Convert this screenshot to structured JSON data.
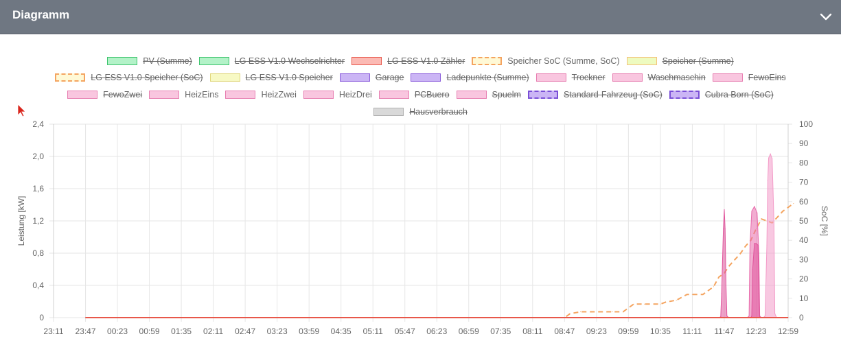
{
  "panel": {
    "title": "Diagramm",
    "collapse_icon": "chevron-down-icon",
    "header_color": "#6f7782"
  },
  "chart_data": {
    "type": "area",
    "title": "",
    "ylabel": "Leistung [kW]",
    "y2label": "SoC [%]",
    "ylim": [
      0,
      2.4
    ],
    "y2lim": [
      0,
      100
    ],
    "y_ticks": [
      "0",
      "0,4",
      "0,8",
      "1,2",
      "1,6",
      "2,0",
      "2,4"
    ],
    "y2_ticks": [
      "0",
      "10",
      "20",
      "30",
      "40",
      "50",
      "60",
      "70",
      "80",
      "90",
      "100"
    ],
    "x_ticks": [
      "23:11",
      "23:47",
      "00:23",
      "00:59",
      "01:35",
      "02:11",
      "02:47",
      "03:23",
      "03:59",
      "04:35",
      "05:11",
      "05:47",
      "06:23",
      "06:59",
      "07:35",
      "08:11",
      "08:47",
      "09:23",
      "09:59",
      "10:35",
      "11:11",
      "11:47",
      "12:23",
      "12:59"
    ],
    "grid": true,
    "legend_position": "top",
    "legend_rows": [
      [
        {
          "label": "PV (Summe)",
          "hidden": true,
          "fill": "#b3f2c8",
          "stroke": "#3cc36c",
          "dashed": false
        },
        {
          "label": "LG ESS V1.0 Wechselrichter",
          "hidden": true,
          "fill": "#b3f2c8",
          "stroke": "#3cc36c",
          "dashed": false
        },
        {
          "label": "LG ESS V1.0 Zähler",
          "hidden": true,
          "fill": "#fbbab4",
          "stroke": "#e8574a",
          "dashed": false
        },
        {
          "label": "Speicher SoC (Summe, SoC)",
          "hidden": false,
          "fill": "#fff9d6",
          "stroke": "#f4a460",
          "dashed": true
        },
        {
          "label": "Speicher (Summe)",
          "hidden": true,
          "fill": "#eefbc0",
          "stroke": "#f4c27a",
          "dashed": false
        }
      ],
      [
        {
          "label": "LG ESS V1.0 Speicher (SoC)",
          "hidden": true,
          "fill": "#fff9d6",
          "stroke": "#f4a460",
          "dashed": true
        },
        {
          "label": "LG ESS V1.0 Speicher",
          "hidden": true,
          "fill": "#f7f9c4",
          "stroke": "#e0d67a",
          "dashed": false
        },
        {
          "label": "Garage",
          "hidden": true,
          "fill": "#cbb5f5",
          "stroke": "#8a5cdb",
          "dashed": false
        },
        {
          "label": "Ladepunkte (Summe)",
          "hidden": true,
          "fill": "#cbb5f5",
          "stroke": "#8a5cdb",
          "dashed": false
        },
        {
          "label": "Trockner",
          "hidden": true,
          "fill": "#f9c6df",
          "stroke": "#e77fb1",
          "dashed": false
        },
        {
          "label": "Waschmaschin",
          "hidden": true,
          "fill": "#f9c6df",
          "stroke": "#e77fb1",
          "dashed": false
        },
        {
          "label": "FewoEins",
          "hidden": true,
          "fill": "#f9c6df",
          "stroke": "#e77fb1",
          "dashed": false
        }
      ],
      [
        {
          "label": "FewoZwei",
          "hidden": true,
          "fill": "#f9c6df",
          "stroke": "#e77fb1",
          "dashed": false
        },
        {
          "label": "HeizEins",
          "hidden": false,
          "fill": "#f9c6df",
          "stroke": "#e77fb1",
          "dashed": false
        },
        {
          "label": "HeizZwei",
          "hidden": false,
          "fill": "#f9c6df",
          "stroke": "#e77fb1",
          "dashed": false
        },
        {
          "label": "HeizDrei",
          "hidden": false,
          "fill": "#f9c6df",
          "stroke": "#e77fb1",
          "dashed": false
        },
        {
          "label": "PCBuero",
          "hidden": true,
          "fill": "#f9c6df",
          "stroke": "#e77fb1",
          "dashed": false
        },
        {
          "label": "Spuelm",
          "hidden": true,
          "fill": "#f9c6df",
          "stroke": "#e77fb1",
          "dashed": false
        },
        {
          "label": "Standard-Fahrzeug (SoC)",
          "hidden": true,
          "fill": "#cbb5f5",
          "stroke": "#7a4fd6",
          "dashed": true
        },
        {
          "label": "Cubra Born (SoC)",
          "hidden": true,
          "fill": "#cbb5f5",
          "stroke": "#7a4fd6",
          "dashed": true
        }
      ],
      [
        {
          "label": "Hausverbrauch",
          "hidden": true,
          "fill": "#d9d9d9",
          "stroke": "#b0b0b0",
          "dashed": false
        }
      ]
    ],
    "series": [
      {
        "name": "Speicher SoC (Summe, SoC)",
        "axis": "right",
        "color": "#f4a460",
        "dashed": true,
        "x": [
          "00:00",
          "08:47",
          "08:53",
          "09:05",
          "09:17",
          "09:29",
          "09:41",
          "09:53",
          "10:05",
          "10:17",
          "10:29",
          "10:35",
          "10:41",
          "10:53",
          "11:05",
          "11:11",
          "11:23",
          "11:35",
          "11:41",
          "11:47",
          "11:53",
          "12:05",
          "12:11",
          "12:17",
          "12:23",
          "12:29",
          "12:35",
          "12:41",
          "12:47",
          "12:53",
          "12:59",
          "13:05"
        ],
        "y": [
          0,
          0,
          2,
          3,
          3,
          3,
          3,
          3,
          7,
          7,
          7,
          7,
          8,
          9,
          12,
          12,
          12,
          16,
          21,
          23,
          27,
          33,
          37,
          40,
          46,
          51,
          50,
          49,
          52,
          55,
          57,
          59
        ]
      },
      {
        "name": "HeizEins",
        "axis": "left",
        "color": "#e0559c",
        "x": [
          "11:41",
          "11:43",
          "11:44",
          "11:46",
          "11:47",
          "11:48",
          "11:49",
          "11:50",
          "11:52",
          "11:54"
        ],
        "y": [
          0,
          0.01,
          0.3,
          1.1,
          1.34,
          1.1,
          0.4,
          0.02,
          0,
          0
        ]
      },
      {
        "name": "HeizZwei",
        "axis": "left",
        "color": "#e86aab",
        "x": [
          "12:13",
          "12:15",
          "12:16",
          "12:18",
          "12:21",
          "12:24",
          "12:26",
          "12:27",
          "12:29"
        ],
        "y": [
          0,
          0.02,
          0.9,
          1.32,
          1.38,
          1.3,
          0.8,
          0.02,
          0
        ]
      },
      {
        "name": "HeizDrei",
        "axis": "left",
        "color": "#e0559c",
        "x": [
          "12:17",
          "12:18",
          "12:19",
          "12:21",
          "12:23",
          "12:25",
          "12:26",
          "12:27"
        ],
        "y": [
          0,
          0.02,
          0.6,
          0.92,
          0.92,
          0.9,
          0.3,
          0
        ]
      },
      {
        "name": "",
        "axis": "left",
        "color": "#f39bc8",
        "x": [
          "12:31",
          "12:33",
          "12:35",
          "12:36",
          "12:37",
          "12:39",
          "12:41",
          "12:43",
          "12:44",
          "12:46"
        ],
        "y": [
          0,
          0.02,
          0.9,
          1.7,
          1.98,
          2.03,
          1.97,
          1.2,
          0.05,
          0
        ]
      },
      {
        "name": "",
        "axis": "left",
        "color": "#e8574a",
        "x": [
          "23:47",
          "12:59"
        ],
        "y": [
          0,
          0
        ]
      }
    ]
  }
}
